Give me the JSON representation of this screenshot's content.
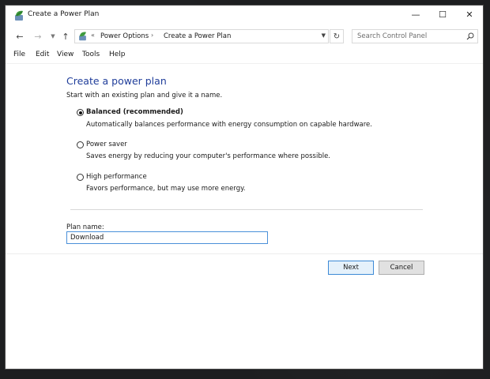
{
  "window": {
    "title": "Create a Power Plan"
  },
  "caption_buttons": {
    "minimize": "—",
    "maximize": "☐",
    "close": "✕"
  },
  "nav": {
    "back": "←",
    "forward": "→",
    "recent": "▼",
    "up": "↑",
    "refresh": "↻"
  },
  "address": {
    "prefix": "«",
    "crumbs": [
      "Power Options",
      "Create a Power Plan"
    ],
    "separator": "›",
    "dropdown": "▼"
  },
  "search": {
    "placeholder": "Search Control Panel"
  },
  "menu": {
    "items": [
      "File",
      "Edit",
      "View",
      "Tools",
      "Help"
    ]
  },
  "main": {
    "heading": "Create a power plan",
    "intro": "Start with an existing plan and give it a name.",
    "options": [
      {
        "label": "Balanced (recommended)",
        "description": "Automatically balances performance with energy consumption on capable hardware.",
        "selected": true
      },
      {
        "label": "Power saver",
        "description": "Saves energy by reducing your computer's performance where possible.",
        "selected": false
      },
      {
        "label": "High performance",
        "description": "Favors performance, but may use more energy.",
        "selected": false
      }
    ],
    "plan_name_label": "Plan name:",
    "plan_name_value": "Download"
  },
  "buttons": {
    "next": "Next",
    "cancel": "Cancel"
  },
  "colors": {
    "heading": "#1f3d9a",
    "focus_border": "#4a90d9",
    "next_bg": "#e5f1fb",
    "cancel_bg": "#e1e1e1"
  },
  "icons": {
    "app": "power-options-icon",
    "search": "magnifier-icon"
  }
}
